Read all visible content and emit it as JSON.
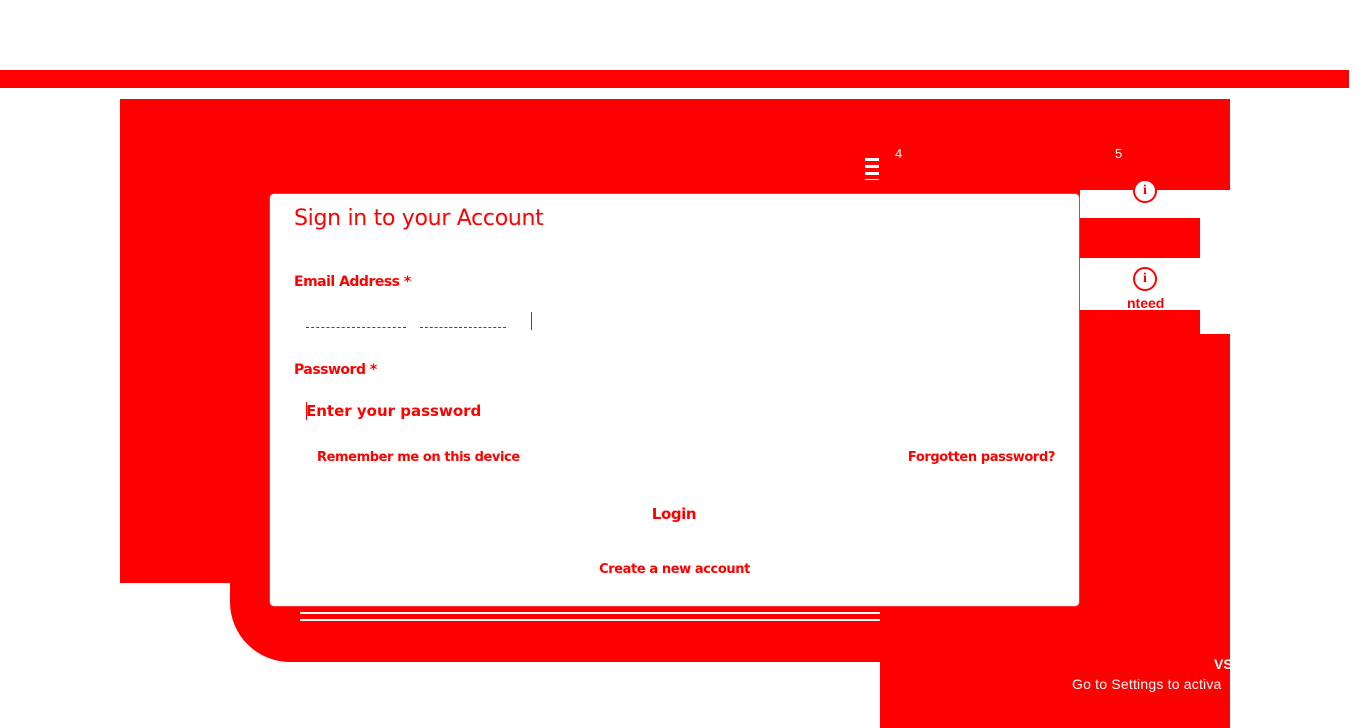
{
  "login_modal": {
    "title": "Sign in to your Account",
    "email_label": "Email Address *",
    "password_label": "Password *",
    "password_placeholder": "Enter your password",
    "remember_label": "Remember me on this device",
    "forgot_link": "Forgotten password?",
    "login_button": "Login",
    "create_account_link": "Create a new account"
  },
  "background": {
    "info_label": "nteed",
    "activate_heading": "VS",
    "activate_text": "Go to Settings to activa",
    "small_number_left": "4",
    "small_number_right": "5",
    "accent_color": "#ff0000"
  }
}
